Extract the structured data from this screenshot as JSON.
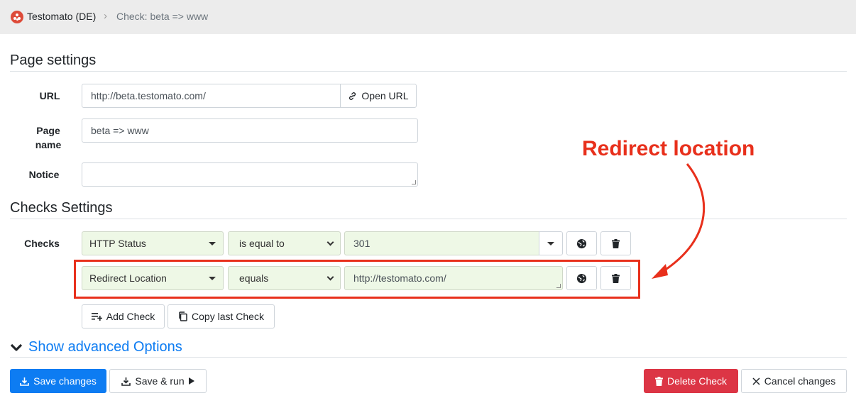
{
  "breadcrumb": {
    "home": "Testomato (DE)",
    "separator": "›",
    "current": "Check: beta => www"
  },
  "page_settings": {
    "title": "Page settings",
    "url_label": "URL",
    "url_value": "http://beta.testomato.com/",
    "open_url_label": "Open URL",
    "page_name_label_1": "Page",
    "page_name_label_2": "name",
    "page_name_value": "beta => www",
    "notice_label": "Notice",
    "notice_value": ""
  },
  "checks_settings": {
    "title": "Checks Settings",
    "checks_label": "Checks",
    "rows": [
      {
        "type": "HTTP Status",
        "operator": "is equal to",
        "value": "301"
      },
      {
        "type": "Redirect Location",
        "operator": "equals",
        "value": "http://testomato.com/"
      }
    ],
    "add_check_label": "Add Check",
    "copy_last_check_label": "Copy last Check"
  },
  "advanced": {
    "label": "Show advanced Options"
  },
  "actions": {
    "save_changes": "Save changes",
    "save_and_run": "Save & run",
    "delete_check": "Delete Check",
    "cancel_changes": "Cancel changes"
  },
  "annotation": {
    "text": "Redirect location"
  },
  "colors": {
    "accent": "#0d7cf2",
    "danger": "#dc3545",
    "annotation": "#e8301c",
    "field_green": "#eef8e6"
  },
  "icons": [
    "testomato-logo-icon",
    "link-icon",
    "globe-icon",
    "trash-icon",
    "add-list-icon",
    "copy-icon",
    "chevron-down-icon",
    "download-icon",
    "play-icon",
    "close-icon"
  ]
}
